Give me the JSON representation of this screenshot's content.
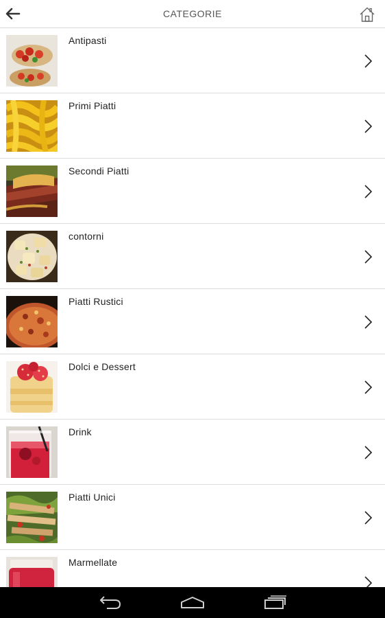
{
  "header": {
    "title": "CATEGORIE",
    "back_icon": "arrow-left-icon",
    "home_icon": "home-icon"
  },
  "categories": [
    {
      "label": "Antipasti",
      "image": "antipasti-photo"
    },
    {
      "label": "Primi Piatti",
      "image": "primi-piatti-photo"
    },
    {
      "label": "Secondi Piatti",
      "image": "secondi-piatti-photo"
    },
    {
      "label": "contorni",
      "image": "contorni-photo"
    },
    {
      "label": "Piatti Rustici",
      "image": "piatti-rustici-photo"
    },
    {
      "label": "Dolci e Dessert",
      "image": "dolci-dessert-photo"
    },
    {
      "label": "Drink",
      "image": "drink-photo"
    },
    {
      "label": "Piatti Unici",
      "image": "piatti-unici-photo"
    },
    {
      "label": "Marmellate",
      "image": "marmellate-photo"
    }
  ],
  "navbar": {
    "back_icon": "nav-back-icon",
    "home_icon": "nav-home-icon",
    "recents_icon": "nav-recents-icon",
    "background": "#000000"
  }
}
